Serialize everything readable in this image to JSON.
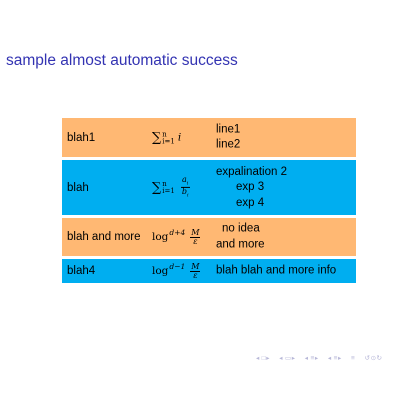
{
  "frame": {
    "title": "sample almost automatic success"
  },
  "rows": [
    {
      "name": "blah1",
      "math": {
        "kind": "sum",
        "upper": "n",
        "lower": "i=1",
        "body": "i"
      },
      "lines": [
        "line1",
        "line2"
      ],
      "color": "#ffb873"
    },
    {
      "name": "blah",
      "math": {
        "kind": "sum-frac",
        "upper": "n",
        "lower": "i=1",
        "num": "a",
        "den": "b"
      },
      "lines": [
        "expalination 2",
        "exp 3",
        "exp 4"
      ],
      "color": "#00aef0"
    },
    {
      "name": "blah and more",
      "math": {
        "kind": "log-frac",
        "base": "log",
        "exp": "d+4",
        "num": "M",
        "den": "ε"
      },
      "lines": [
        "no idea",
        "and more"
      ],
      "color": "#ffb873"
    },
    {
      "name": "blah4",
      "math": {
        "kind": "log-frac",
        "base": "log",
        "exp": "d−1",
        "num": "M",
        "den": "ε"
      },
      "lines": [
        "blah blah and more info"
      ],
      "color": "#00aef0"
    }
  ],
  "nav": {
    "icons": [
      "nav-prev-frame-icon",
      "nav-next-frame-icon",
      "nav-prev-subsection-icon",
      "nav-next-subsection-icon",
      "nav-prev-section-icon",
      "nav-next-section-icon",
      "nav-prev-slide-icon",
      "nav-next-slide-icon",
      "nav-align-icon",
      "nav-search-icon"
    ],
    "color": "#b8b8d8"
  }
}
